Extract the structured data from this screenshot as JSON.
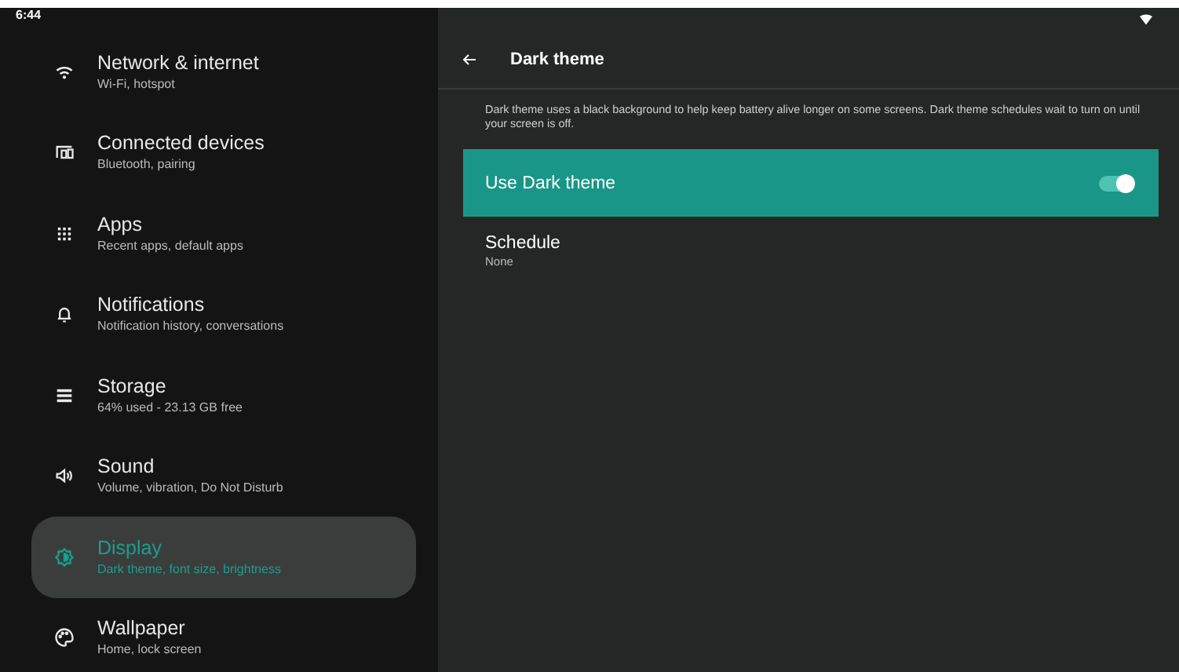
{
  "status_bar": {
    "time": "6:44"
  },
  "sidebar": {
    "items": [
      {
        "kind": "wifi",
        "title": "Network & internet",
        "subtitle": "Wi-Fi, hotspot",
        "selected": false
      },
      {
        "kind": "devices",
        "title": "Connected devices",
        "subtitle": "Bluetooth, pairing",
        "selected": false
      },
      {
        "kind": "apps",
        "title": "Apps",
        "subtitle": "Recent apps, default apps",
        "selected": false
      },
      {
        "kind": "bell",
        "title": "Notifications",
        "subtitle": "Notification history, conversations",
        "selected": false
      },
      {
        "kind": "storage",
        "title": "Storage",
        "subtitle": "64% used - 23.13 GB free",
        "selected": false
      },
      {
        "kind": "sound",
        "title": "Sound",
        "subtitle": "Volume, vibration, Do Not Disturb",
        "selected": false
      },
      {
        "kind": "display",
        "title": "Display",
        "subtitle": "Dark theme, font size, brightness",
        "selected": true
      },
      {
        "kind": "palette",
        "title": "Wallpaper",
        "subtitle": "Home, lock screen",
        "selected": false
      }
    ]
  },
  "detail": {
    "title": "Dark theme",
    "description": "Dark theme uses a black background to help keep battery alive longer on some screens. Dark theme schedules wait to turn on until your screen is off.",
    "toggle": {
      "label": "Use Dark theme",
      "on": true
    },
    "schedule": {
      "title": "Schedule",
      "value": "None"
    }
  }
}
